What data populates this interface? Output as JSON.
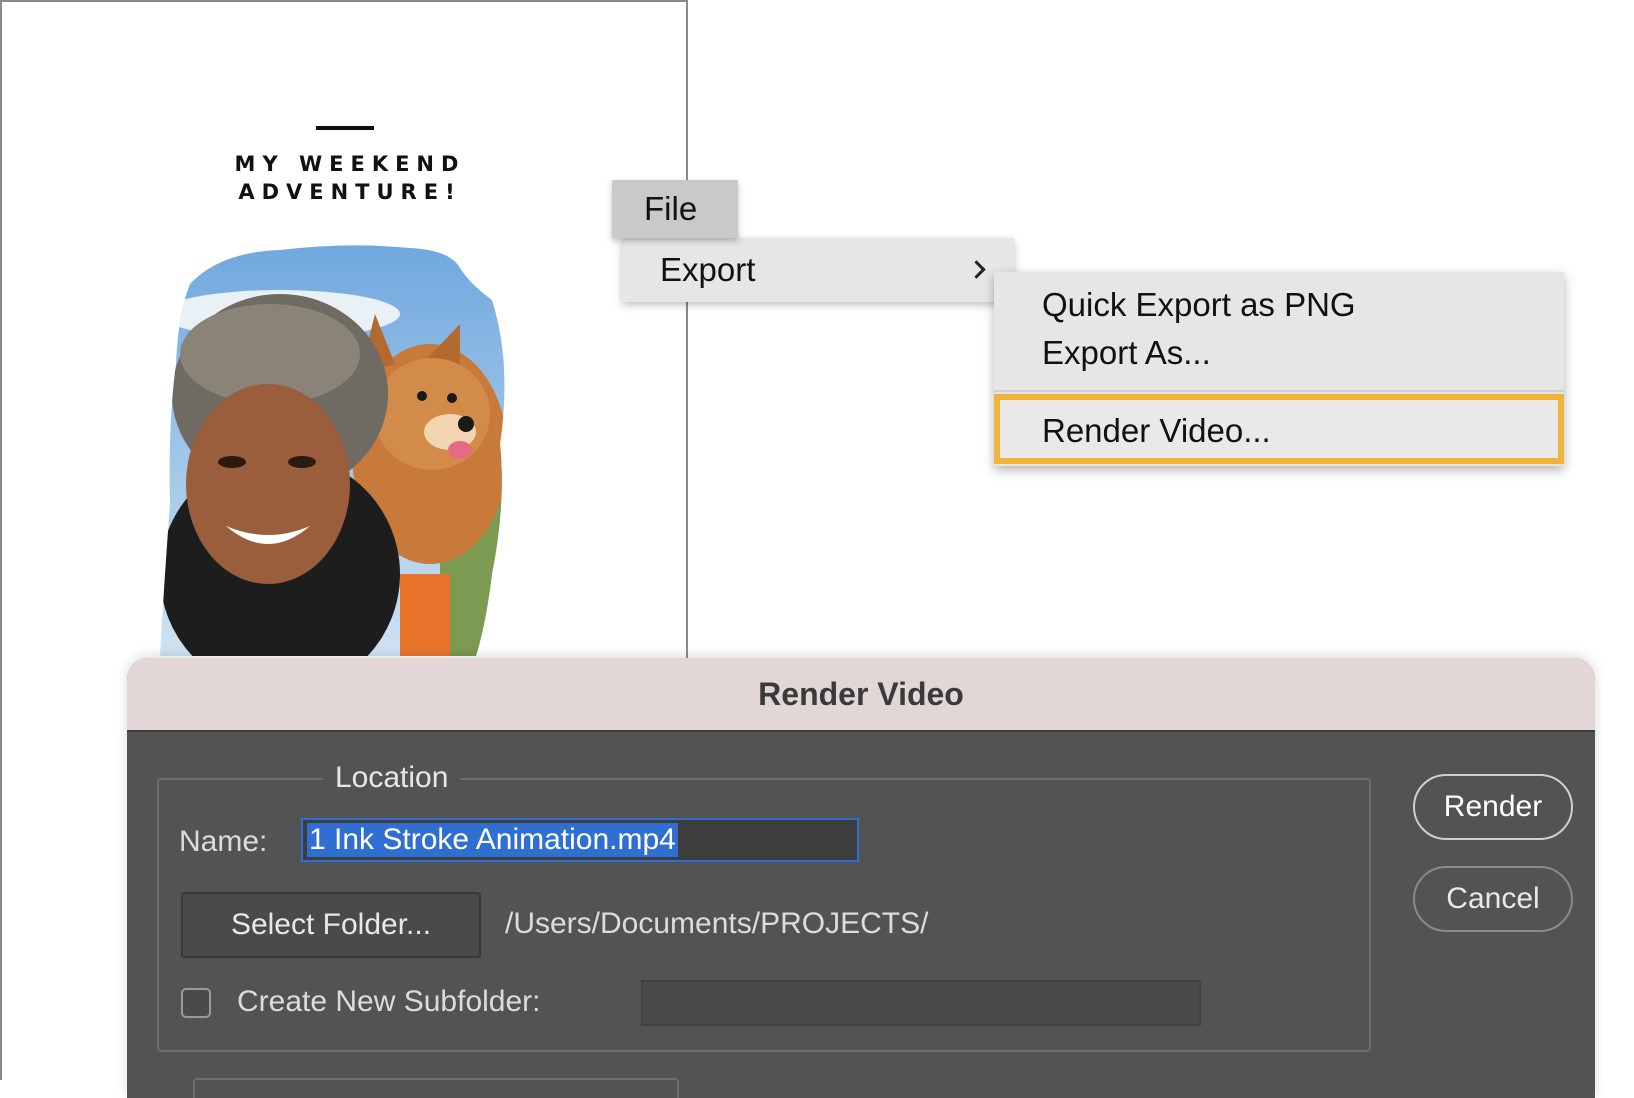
{
  "document": {
    "title_line1": "MY WEEKEND",
    "title_line2": "ADVENTURE!"
  },
  "menu": {
    "file_label": "File",
    "export_label": "Export",
    "submenu": {
      "quick_export": "Quick Export as PNG",
      "export_as": "Export As...",
      "render_video": "Render Video..."
    },
    "highlight_color": "#f0b43c"
  },
  "dialog": {
    "title": "Render Video",
    "location_legend": "Location",
    "name_label": "Name:",
    "name_value": "1 Ink Stroke Animation.mp4",
    "select_folder_label": "Select Folder...",
    "folder_path": "/Users/Documents/PROJECTS/",
    "create_subfolder_label": "Create New Subfolder:",
    "create_subfolder_checked": false,
    "subfolder_value": "",
    "render_label": "Render",
    "cancel_label": "Cancel"
  }
}
